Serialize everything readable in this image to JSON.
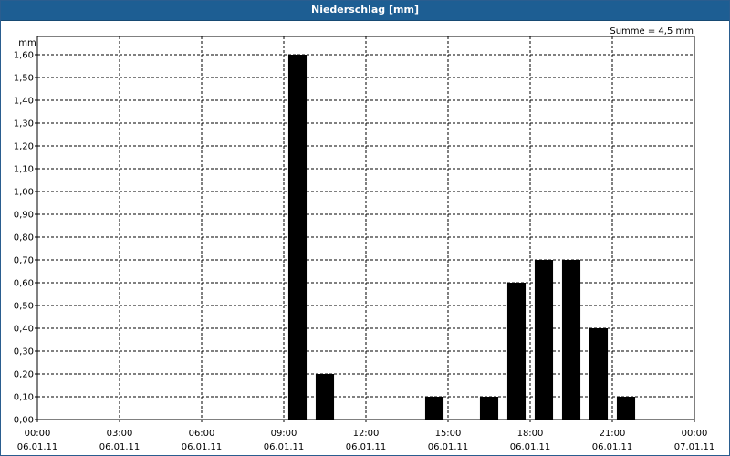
{
  "window": {
    "title": "Niederschlag [mm]"
  },
  "chart_data": {
    "type": "bar",
    "title": "Niederschlag [mm]",
    "ylabel": "mm",
    "annotation": "Summe = 4,5 mm",
    "ylim": [
      0,
      1.6
    ],
    "yticks": [
      "0,00",
      "0,10",
      "0,20",
      "0,30",
      "0,40",
      "0,50",
      "0,60",
      "0,70",
      "0,80",
      "0,90",
      "1,00",
      "1,10",
      "1,20",
      "1,30",
      "1,40",
      "1,50",
      "1,60"
    ],
    "xlim_hours": [
      0,
      24
    ],
    "xticks": [
      {
        "time": "00:00",
        "date": "06.01.11"
      },
      {
        "time": "03:00",
        "date": "06.01.11"
      },
      {
        "time": "06:00",
        "date": "06.01.11"
      },
      {
        "time": "09:00",
        "date": "06.01.11"
      },
      {
        "time": "12:00",
        "date": "06.01.11"
      },
      {
        "time": "15:00",
        "date": "06.01.11"
      },
      {
        "time": "18:00",
        "date": "06.01.11"
      },
      {
        "time": "21:00",
        "date": "06.01.11"
      },
      {
        "time": "00:00",
        "date": "07.01.11"
      }
    ],
    "grid": true,
    "bar_color": "#000000",
    "bars": [
      {
        "hour": 9,
        "value": 1.6
      },
      {
        "hour": 10,
        "value": 0.2
      },
      {
        "hour": 14,
        "value": 0.1
      },
      {
        "hour": 16,
        "value": 0.1
      },
      {
        "hour": 17,
        "value": 0.6
      },
      {
        "hour": 18,
        "value": 0.7
      },
      {
        "hour": 19,
        "value": 0.7
      },
      {
        "hour": 20,
        "value": 0.4
      },
      {
        "hour": 21,
        "value": 0.1
      }
    ]
  }
}
